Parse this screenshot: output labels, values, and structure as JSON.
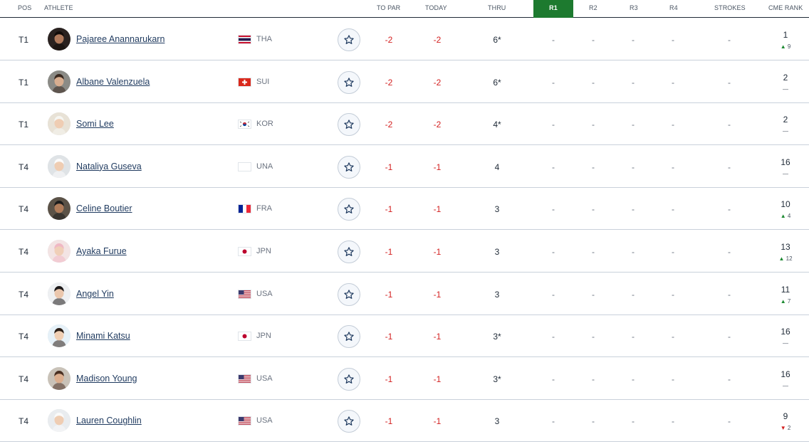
{
  "columns": {
    "pos": "POS",
    "athlete": "ATHLETE",
    "to_par": "TO PAR",
    "today": "TODAY",
    "thru": "THRU",
    "r1": "R1",
    "r2": "R2",
    "r3": "R3",
    "r4": "R4",
    "strokes": "STROKES",
    "cme_rank": "CME RANK"
  },
  "colors": {
    "active_round": "#1d7a2f",
    "under_par": "#d31f1f",
    "rank_up": "#1d8a32",
    "rank_down": "#d31f1f",
    "link": "#1f3a5f"
  },
  "players": [
    {
      "pos": "T1",
      "name": "Pajaree Anannarukarn",
      "country": "THA",
      "flag": "flag-thailand",
      "to_par": "-2",
      "today": "-2",
      "thru": "6*",
      "r1": "-",
      "r2": "-",
      "r3": "-",
      "r4": "-",
      "strokes": "-",
      "cme_rank": "1",
      "move_dir": "up",
      "move_arrow": "▲",
      "move": "9",
      "avatar": {
        "bg": "#2a2220",
        "skin": "#b07a5c",
        "hair": "#120c0a"
      }
    },
    {
      "pos": "T1",
      "name": "Albane Valenzuela",
      "country": "SUI",
      "flag": "flag-switzerland",
      "to_par": "-2",
      "today": "-2",
      "thru": "6*",
      "r1": "-",
      "r2": "-",
      "r3": "-",
      "r4": "-",
      "strokes": "-",
      "cme_rank": "2",
      "move_dir": "none",
      "move_arrow": "",
      "move": "—",
      "avatar": {
        "bg": "#8b8b86",
        "skin": "#d8ae90",
        "hair": "#3a2a20"
      }
    },
    {
      "pos": "T1",
      "name": "Somi Lee",
      "country": "KOR",
      "flag": "flag-korea",
      "to_par": "-2",
      "today": "-2",
      "thru": "4*",
      "r1": "-",
      "r2": "-",
      "r3": "-",
      "r4": "-",
      "strokes": "-",
      "cme_rank": "2",
      "move_dir": "none",
      "move_arrow": "",
      "move": "—",
      "avatar": {
        "bg": "#e8e2d6",
        "skin": "#efcdb3",
        "hair": "#f6f6f2"
      }
    },
    {
      "pos": "T4",
      "name": "Nataliya Guseva",
      "country": "UNA",
      "flag": "flag-blank",
      "to_par": "-1",
      "today": "-1",
      "thru": "4",
      "r1": "-",
      "r2": "-",
      "r3": "-",
      "r4": "-",
      "strokes": "-",
      "cme_rank": "16",
      "move_dir": "none",
      "move_arrow": "",
      "move": "—",
      "avatar": {
        "bg": "#dfe3e6",
        "skin": "#efcdb3",
        "hair": "#fbfbfb"
      }
    },
    {
      "pos": "T4",
      "name": "Celine Boutier",
      "country": "FRA",
      "flag": "flag-france",
      "to_par": "-1",
      "today": "-1",
      "thru": "3",
      "r1": "-",
      "r2": "-",
      "r3": "-",
      "r4": "-",
      "strokes": "-",
      "cme_rank": "10",
      "move_dir": "up",
      "move_arrow": "▲",
      "move": "4",
      "avatar": {
        "bg": "#5b5247",
        "skin": "#b07c5a",
        "hair": "#1c1c1c"
      }
    },
    {
      "pos": "T4",
      "name": "Ayaka Furue",
      "country": "JPN",
      "flag": "flag-japan",
      "to_par": "-1",
      "today": "-1",
      "thru": "3",
      "r1": "-",
      "r2": "-",
      "r3": "-",
      "r4": "-",
      "strokes": "-",
      "cme_rank": "13",
      "move_dir": "up",
      "move_arrow": "▲",
      "move": "12",
      "avatar": {
        "bg": "#f3e4e4",
        "skin": "#f0cfb8",
        "hair": "#f0b8c4"
      }
    },
    {
      "pos": "T4",
      "name": "Angel Yin",
      "country": "USA",
      "flag": "flag-usa",
      "to_par": "-1",
      "today": "-1",
      "thru": "3",
      "r1": "-",
      "r2": "-",
      "r3": "-",
      "r4": "-",
      "strokes": "-",
      "cme_rank": "11",
      "move_dir": "up",
      "move_arrow": "▲",
      "move": "7",
      "avatar": {
        "bg": "#eef0f2",
        "skin": "#ebc7ad",
        "hair": "#1d1a1a"
      }
    },
    {
      "pos": "T4",
      "name": "Minami Katsu",
      "country": "JPN",
      "flag": "flag-japan",
      "to_par": "-1",
      "today": "-1",
      "thru": "3*",
      "r1": "-",
      "r2": "-",
      "r3": "-",
      "r4": "-",
      "strokes": "-",
      "cme_rank": "16",
      "move_dir": "none",
      "move_arrow": "",
      "move": "—",
      "avatar": {
        "bg": "#e6f1f8",
        "skin": "#f0cfb4",
        "hair": "#2b1e16"
      }
    },
    {
      "pos": "T4",
      "name": "Madison Young",
      "country": "USA",
      "flag": "flag-usa",
      "to_par": "-1",
      "today": "-1",
      "thru": "3*",
      "r1": "-",
      "r2": "-",
      "r3": "-",
      "r4": "-",
      "strokes": "-",
      "cme_rank": "16",
      "move_dir": "none",
      "move_arrow": "",
      "move": "—",
      "avatar": {
        "bg": "#c9c2b8",
        "skin": "#dcae8e",
        "hair": "#4a3022"
      }
    },
    {
      "pos": "T4",
      "name": "Lauren Coughlin",
      "country": "USA",
      "flag": "flag-usa",
      "to_par": "-1",
      "today": "-1",
      "thru": "3",
      "r1": "-",
      "r2": "-",
      "r3": "-",
      "r4": "-",
      "strokes": "-",
      "cme_rank": "9",
      "move_dir": "down",
      "move_arrow": "▼",
      "move": "2",
      "avatar": {
        "bg": "#e9ecef",
        "skin": "#efcdb3",
        "hair": "#fafafa"
      }
    }
  ]
}
